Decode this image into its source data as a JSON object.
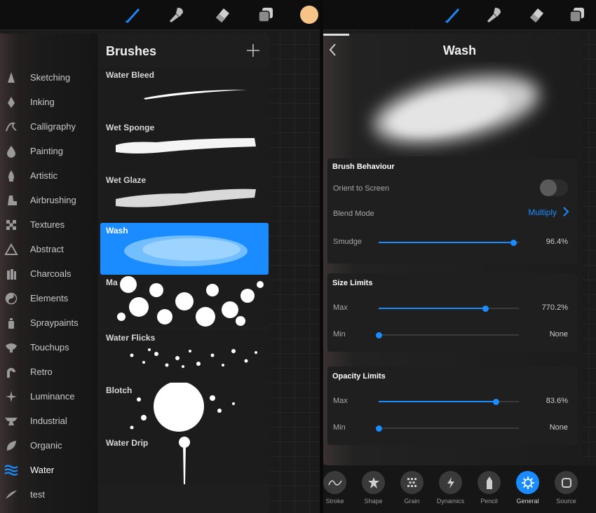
{
  "left": {
    "toolbar": {
      "color_swatch": "#f6c486"
    },
    "brushes_title": "Brushes",
    "categories": [
      {
        "label": "Sketching"
      },
      {
        "label": "Inking"
      },
      {
        "label": "Calligraphy"
      },
      {
        "label": "Painting"
      },
      {
        "label": "Artistic"
      },
      {
        "label": "Airbrushing"
      },
      {
        "label": "Textures"
      },
      {
        "label": "Abstract"
      },
      {
        "label": "Charcoals"
      },
      {
        "label": "Elements"
      },
      {
        "label": "Spraypaints"
      },
      {
        "label": "Touchups"
      },
      {
        "label": "Retro"
      },
      {
        "label": "Luminance"
      },
      {
        "label": "Industrial"
      },
      {
        "label": "Organic"
      },
      {
        "label": "Water"
      },
      {
        "label": "test"
      }
    ],
    "brushes": [
      {
        "label": "Water Bleed"
      },
      {
        "label": "Wet Sponge"
      },
      {
        "label": "Wet Glaze"
      },
      {
        "label": "Wash"
      },
      {
        "label": "Ma"
      },
      {
        "label": "Water Flicks"
      },
      {
        "label": "Blotch"
      },
      {
        "label": "Water Drip"
      }
    ]
  },
  "right": {
    "title": "Wash",
    "brush_behaviour": {
      "title": "Brush Behaviour",
      "orient_label": "Orient to Screen",
      "blend_label": "Blend Mode",
      "blend_value": "Multiply",
      "smudge_label": "Smudge",
      "smudge_value": "96.4%"
    },
    "size_limits": {
      "title": "Size Limits",
      "max_label": "Max",
      "max_value": "770.2%",
      "min_label": "Min",
      "min_value": "None"
    },
    "opacity_limits": {
      "title": "Opacity Limits",
      "max_label": "Max",
      "max_value": "83.6%",
      "min_label": "Min",
      "min_value": "None"
    },
    "slider_levels": {
      "smudge": 0.964,
      "size_max": 0.76,
      "size_min": 0.0,
      "opacity_max": 0.836,
      "opacity_min": 0.0
    },
    "tabs": [
      {
        "label": "Stroke"
      },
      {
        "label": "Shape"
      },
      {
        "label": "Grain"
      },
      {
        "label": "Dynamics"
      },
      {
        "label": "Pencil"
      },
      {
        "label": "General"
      },
      {
        "label": "Source"
      }
    ]
  },
  "colors": {
    "accent": "#1a8cff"
  }
}
